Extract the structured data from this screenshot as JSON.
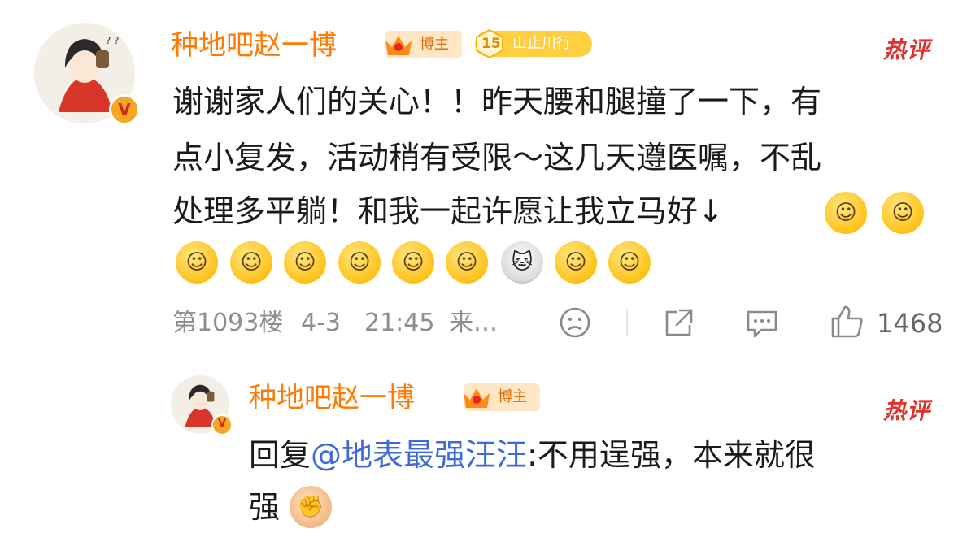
{
  "comment": {
    "username": "种地吧赵一博",
    "blogger_badge": "博主",
    "fan_badge_level": "15",
    "fan_badge_name": "山止川行",
    "hot_tag": "热评",
    "text_lines": [
      "谢谢家人们的关心！！昨天腰和腿撞了一下，有",
      "点小复发，活动稍有受限～这几天遵医嘱，不乱",
      "处理多平躺！和我一起许愿让我立马好↓"
    ],
    "emojis": [
      "nerd-face-emoji",
      "pleading-face-emoji",
      "praying-face-emoji",
      "grinning-teeth-emoji",
      "laughing-face-emoji",
      "heart-eyes-emoji",
      "hugging-heart-emoji",
      "blushing-hearts-emoji",
      "cat-emoji",
      "content-smile-emoji",
      "smirk-face-emoji"
    ],
    "floor": "第1093楼",
    "date": "4-3",
    "time": "21:45",
    "source": "来…",
    "like_count": "1468"
  },
  "reply": {
    "username": "种地吧赵一博",
    "blogger_badge": "博主",
    "hot_tag": "热评",
    "prefix": "回复",
    "mention": "@地表最强汪汪",
    "line1_rest": ":不用逞强，本来就很",
    "line2": "强",
    "emoji": "fist-emoji"
  },
  "colors": {
    "username": "#ff7a00",
    "mention": "#3d6ad6",
    "hot_tag": "#e0322c",
    "meta": "#8e8e8e"
  }
}
